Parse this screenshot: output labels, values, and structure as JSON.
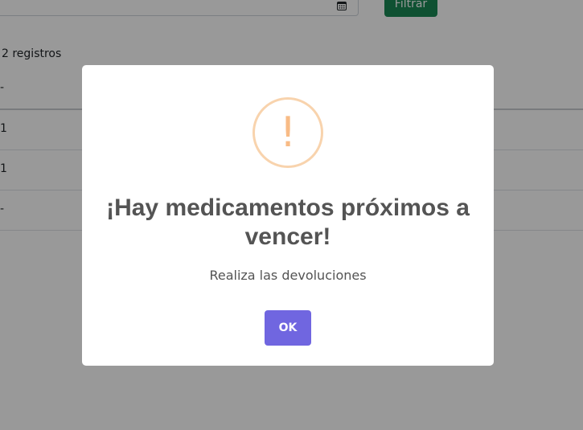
{
  "background": {
    "filter_button_label": "Filtrar",
    "record_count": "2 registros",
    "table": {
      "header_cell": "-",
      "rows": [
        "1",
        "1",
        "-"
      ]
    }
  },
  "alert": {
    "icon": "exclamation",
    "icon_glyph": "!",
    "title": "¡Hay medicamentos próximos a vencer!",
    "text": "Realiza las devoluciones",
    "confirm_label": "OK",
    "confirm_color": "#7066e0",
    "icon_color": "#f8bb86"
  }
}
